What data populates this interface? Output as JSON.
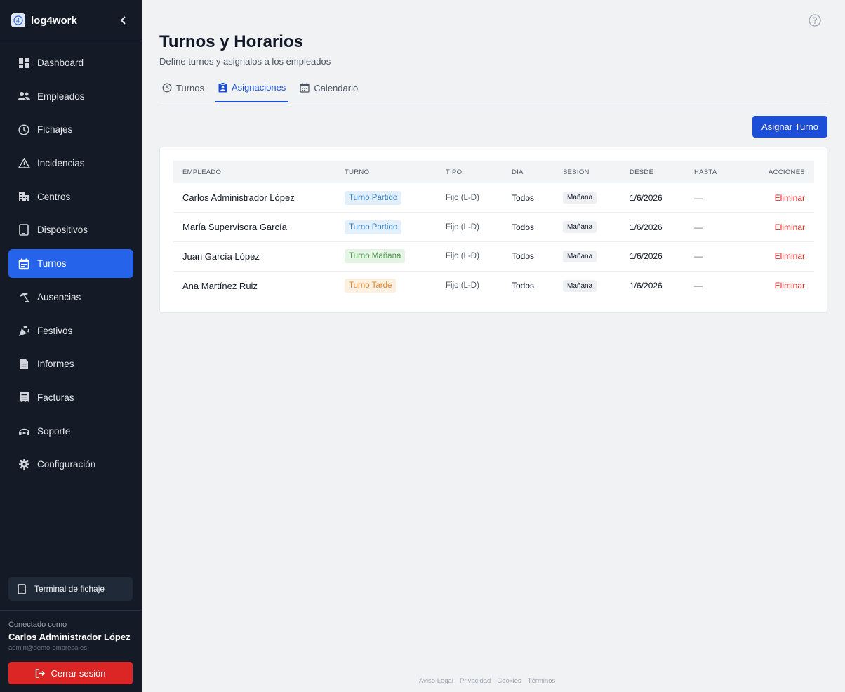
{
  "app": {
    "name": "log4work"
  },
  "sidebar": {
    "items": [
      {
        "label": "Dashboard",
        "icon": "dashboard-icon"
      },
      {
        "label": "Empleados",
        "icon": "people-icon"
      },
      {
        "label": "Fichajes",
        "icon": "clock-icon"
      },
      {
        "label": "Incidencias",
        "icon": "warning-icon"
      },
      {
        "label": "Centros",
        "icon": "building-icon"
      },
      {
        "label": "Dispositivos",
        "icon": "tablet-icon"
      },
      {
        "label": "Turnos",
        "icon": "calendar-icon",
        "active": true
      },
      {
        "label": "Ausencias",
        "icon": "beach-icon"
      },
      {
        "label": "Festivos",
        "icon": "party-icon"
      },
      {
        "label": "Informes",
        "icon": "document-icon"
      },
      {
        "label": "Facturas",
        "icon": "receipt-icon"
      },
      {
        "label": "Soporte",
        "icon": "support-icon"
      },
      {
        "label": "Configuración",
        "icon": "gear-icon"
      }
    ],
    "terminal_label": "Terminal de fichaje",
    "connected_label": "Conectado como",
    "user_name": "Carlos Administrador López",
    "user_email": "admin@demo-empresa.es",
    "logout_label": "Cerrar sesión"
  },
  "header": {
    "title": "Turnos y Horarios",
    "subtitle": "Define turnos y asignalos a los empleados"
  },
  "tabs": [
    {
      "label": "Turnos",
      "icon": "clock-icon"
    },
    {
      "label": "Asignaciones",
      "icon": "assignment-icon",
      "active": true
    },
    {
      "label": "Calendario",
      "icon": "calendar-icon"
    }
  ],
  "assign_button": "Asignar Turno",
  "table": {
    "headers": [
      "EMPLEADO",
      "TURNO",
      "TIPO",
      "DIA",
      "SESION",
      "DESDE",
      "HASTA",
      "ACCIONES"
    ],
    "rows": [
      {
        "employee": "Carlos Administrador López",
        "shift": "Turno Partido",
        "shift_bg": "#e3f0fb",
        "shift_color": "#3b82c4",
        "type": "Fijo (L-D)",
        "day": "Todos",
        "session": "Mañana",
        "from": "1/6/2026",
        "to": "—",
        "action": "Eliminar"
      },
      {
        "employee": "María Supervisora García",
        "shift": "Turno Partido",
        "shift_bg": "#e3f0fb",
        "shift_color": "#3b82c4",
        "type": "Fijo (L-D)",
        "day": "Todos",
        "session": "Mañana",
        "from": "1/6/2026",
        "to": "—",
        "action": "Eliminar"
      },
      {
        "employee": "Juan García López",
        "shift": "Turno Mañana",
        "shift_bg": "#e6f4e6",
        "shift_color": "#4f9a4f",
        "type": "Fijo (L-D)",
        "day": "Todos",
        "session": "Mañana",
        "from": "1/6/2026",
        "to": "—",
        "action": "Eliminar"
      },
      {
        "employee": "Ana Martínez Ruiz",
        "shift": "Turno Tarde",
        "shift_bg": "#fdf0e1",
        "shift_color": "#e08a2e",
        "type": "Fijo (L-D)",
        "day": "Todos",
        "session": "Mañana",
        "from": "1/6/2026",
        "to": "—",
        "action": "Eliminar"
      }
    ]
  },
  "footer": [
    "Aviso Legal",
    "Privacidad",
    "Cookies",
    "Términos"
  ],
  "colors": {
    "accent": "#2563eb",
    "sidebar_bg": "#141b27",
    "danger": "#dc2626"
  }
}
